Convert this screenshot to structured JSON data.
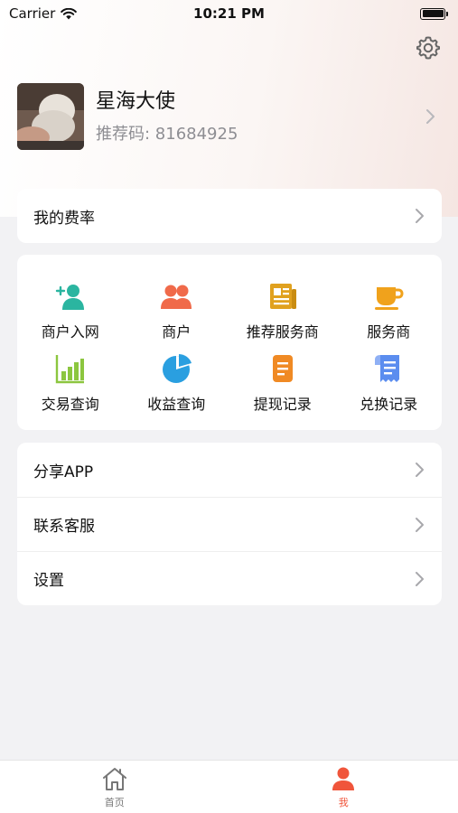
{
  "status_bar": {
    "carrier": "Carrier",
    "time": "10:21 PM"
  },
  "profile": {
    "name": "星海大使",
    "referral_label": "推荐码: ",
    "referral_code": "81684925"
  },
  "rate_row": {
    "label": "我的费率"
  },
  "grid": {
    "items": [
      {
        "label": "商户入网",
        "icon": "add-user-icon",
        "color": "#2bb5a0"
      },
      {
        "label": "商户",
        "icon": "users-icon",
        "color": "#f06a4a"
      },
      {
        "label": "推荐服务商",
        "icon": "newspaper-icon",
        "color": "#e0a11f"
      },
      {
        "label": "服务商",
        "icon": "cup-icon",
        "color": "#f0a21c"
      },
      {
        "label": "交易查询",
        "icon": "bar-chart-icon",
        "color": "#8cc63f"
      },
      {
        "label": "收益查询",
        "icon": "pie-chart-icon",
        "color": "#2a9fe0"
      },
      {
        "label": "提现记录",
        "icon": "document-icon",
        "color": "#f08a24"
      },
      {
        "label": "兑换记录",
        "icon": "receipt-icon",
        "color": "#5b8def"
      }
    ]
  },
  "menu": {
    "items": [
      {
        "label": "分享APP"
      },
      {
        "label": "联系客服"
      },
      {
        "label": "设置"
      }
    ]
  },
  "tabbar": {
    "tabs": [
      {
        "label": "首页",
        "icon": "home-icon",
        "active": false
      },
      {
        "label": "我",
        "icon": "person-icon",
        "active": true
      }
    ],
    "active_color": "#f0553b"
  }
}
